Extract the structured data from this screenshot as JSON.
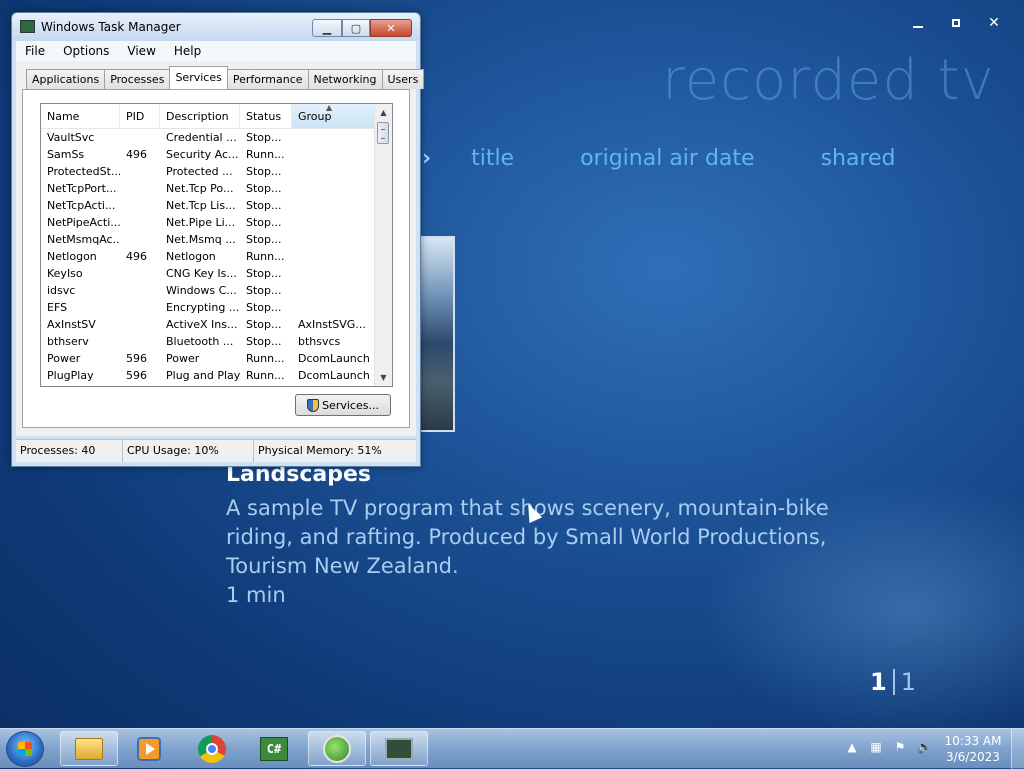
{
  "media_center": {
    "title": "recorded tv",
    "sort_options": [
      "title",
      "original air date",
      "shared"
    ],
    "program": {
      "title": "Landscapes",
      "description": "A sample TV program that shows scenery, mountain-bike riding, and rafting. Produced by Small World Productions, Tourism New Zealand.",
      "duration": "1 min"
    },
    "pager": {
      "current": "1",
      "total": "1"
    }
  },
  "task_manager": {
    "title": "Windows Task Manager",
    "menu": [
      "File",
      "Options",
      "View",
      "Help"
    ],
    "tabs": [
      "Applications",
      "Processes",
      "Services",
      "Performance",
      "Networking",
      "Users"
    ],
    "active_tab": "Services",
    "columns": [
      "Name",
      "PID",
      "Description",
      "Status",
      "Group"
    ],
    "rows": [
      [
        "VaultSvc",
        "",
        "Credential ...",
        "Stop...",
        ""
      ],
      [
        "SamSs",
        "496",
        "Security Ac...",
        "Runn...",
        ""
      ],
      [
        "ProtectedSt...",
        "",
        "Protected ...",
        "Stop...",
        ""
      ],
      [
        "NetTcpPort...",
        "",
        "Net.Tcp Po...",
        "Stop...",
        ""
      ],
      [
        "NetTcpActi...",
        "",
        "Net.Tcp Lis...",
        "Stop...",
        ""
      ],
      [
        "NetPipeActi...",
        "",
        "Net.Pipe Li...",
        "Stop...",
        ""
      ],
      [
        "NetMsmqAc...",
        "",
        "Net.Msmq ...",
        "Stop...",
        ""
      ],
      [
        "Netlogon",
        "496",
        "Netlogon",
        "Runn...",
        ""
      ],
      [
        "KeyIso",
        "",
        "CNG Key Is...",
        "Stop...",
        ""
      ],
      [
        "idsvc",
        "",
        "Windows C...",
        "Stop...",
        ""
      ],
      [
        "EFS",
        "",
        "Encrypting ...",
        "Stop...",
        ""
      ],
      [
        "AxInstSV",
        "",
        "ActiveX Ins...",
        "Stop...",
        "AxInstSVG..."
      ],
      [
        "bthserv",
        "",
        "Bluetooth ...",
        "Stop...",
        "bthsvcs"
      ],
      [
        "Power",
        "596",
        "Power",
        "Runn...",
        "DcomLaunch"
      ],
      [
        "PlugPlay",
        "596",
        "Plug and Play",
        "Runn...",
        "DcomLaunch"
      ]
    ],
    "services_button": "Services...",
    "status": {
      "processes": "Processes: 40",
      "cpu": "CPU Usage: 10%",
      "memory": "Physical Memory: 51%"
    }
  },
  "taskbar": {
    "clock_time": "10:33 AM",
    "clock_date": "3/6/2023"
  }
}
